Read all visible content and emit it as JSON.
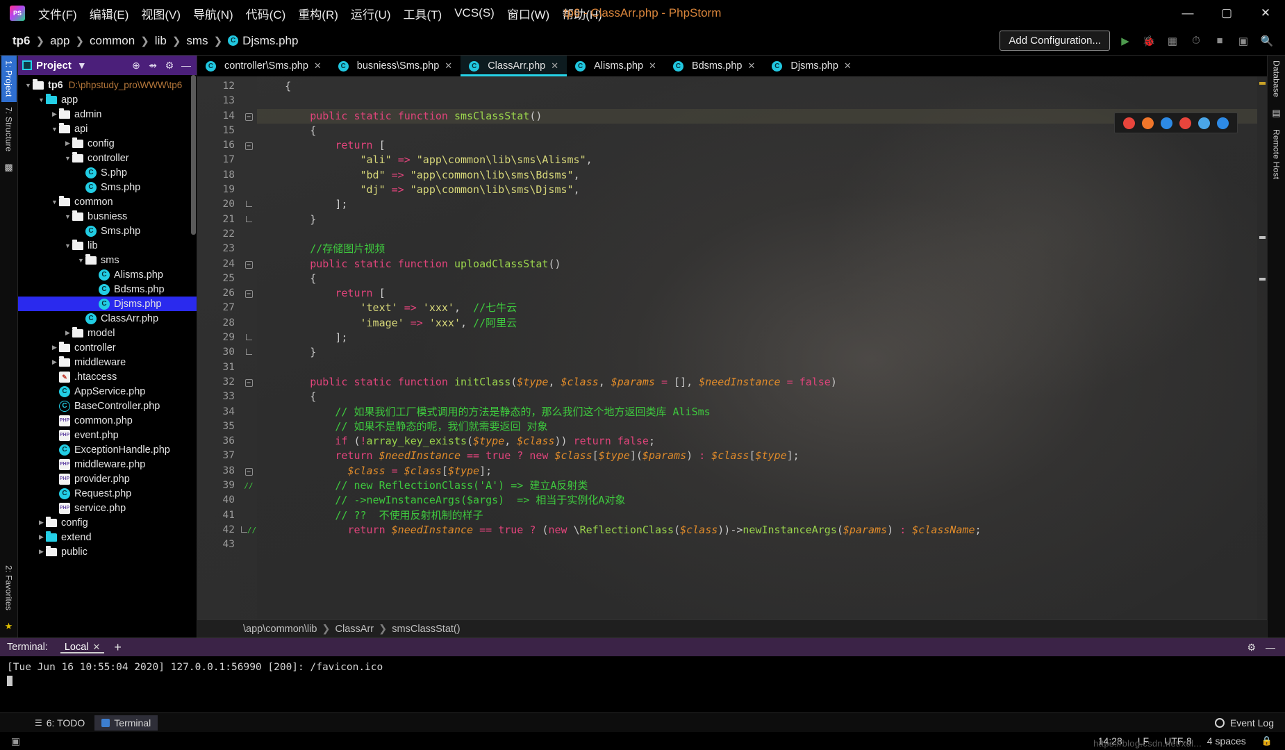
{
  "titlebar": {
    "logo": "phpstorm-logo",
    "menus": [
      "文件(F)",
      "编辑(E)",
      "视图(V)",
      "导航(N)",
      "代码(C)",
      "重构(R)",
      "运行(U)",
      "工具(T)",
      "VCS(S)",
      "窗口(W)",
      "帮助(H)"
    ],
    "window_title": "tp6 - ClassArr.php - PhpStorm",
    "minimize": "—",
    "maximize": "▢",
    "close": "✕"
  },
  "navbar": {
    "breadcrumbs": [
      "tp6",
      "app",
      "common",
      "lib",
      "sms",
      "Djsms.php"
    ],
    "separator": "❯",
    "add_configuration": "Add Configuration...",
    "icons": [
      "run-icon",
      "debug-icon",
      "coverage-icon",
      "profile-icon",
      "stop-icon",
      "layout-icon",
      "search-icon"
    ]
  },
  "left_rail": {
    "tabs": [
      "1: Project",
      "7: Structure"
    ],
    "bottom_tabs": [
      "2: Favorites"
    ]
  },
  "right_rail": {
    "tabs": [
      "Database",
      "Remote Host"
    ]
  },
  "project_panel": {
    "title": "Project",
    "chevron": "▼",
    "icons": [
      "locate-icon",
      "collapse-all-icon",
      "settings-gear-icon",
      "hide-icon"
    ],
    "tree": [
      {
        "label": "tp6",
        "path": "D:\\phpstudy_pro\\WWW\\tp6",
        "depth": 0,
        "arrow": "▼",
        "icon": "folder",
        "selected": false
      },
      {
        "label": "app",
        "path": "",
        "depth": 1,
        "arrow": "▼",
        "icon": "folder-cyan",
        "selected": false
      },
      {
        "label": "admin",
        "path": "",
        "depth": 2,
        "arrow": "▶",
        "icon": "folder",
        "selected": false
      },
      {
        "label": "api",
        "path": "",
        "depth": 2,
        "arrow": "▼",
        "icon": "folder",
        "selected": false
      },
      {
        "label": "config",
        "path": "",
        "depth": 3,
        "arrow": "▶",
        "icon": "folder",
        "selected": false
      },
      {
        "label": "controller",
        "path": "",
        "depth": 3,
        "arrow": "▼",
        "icon": "folder",
        "selected": false
      },
      {
        "label": "S.php",
        "path": "",
        "depth": 4,
        "arrow": "",
        "icon": "php-class",
        "selected": false
      },
      {
        "label": "Sms.php",
        "path": "",
        "depth": 4,
        "arrow": "",
        "icon": "php-class",
        "selected": false
      },
      {
        "label": "common",
        "path": "",
        "depth": 2,
        "arrow": "▼",
        "icon": "folder",
        "selected": false
      },
      {
        "label": "busniess",
        "path": "",
        "depth": 3,
        "arrow": "▼",
        "icon": "folder",
        "selected": false
      },
      {
        "label": "Sms.php",
        "path": "",
        "depth": 4,
        "arrow": "",
        "icon": "php-class",
        "selected": false
      },
      {
        "label": "lib",
        "path": "",
        "depth": 3,
        "arrow": "▼",
        "icon": "folder",
        "selected": false
      },
      {
        "label": "sms",
        "path": "",
        "depth": 4,
        "arrow": "▼",
        "icon": "folder",
        "selected": false
      },
      {
        "label": "Alisms.php",
        "path": "",
        "depth": 5,
        "arrow": "",
        "icon": "php-class",
        "selected": false
      },
      {
        "label": "Bdsms.php",
        "path": "",
        "depth": 5,
        "arrow": "",
        "icon": "php-class",
        "selected": false
      },
      {
        "label": "Djsms.php",
        "path": "",
        "depth": 5,
        "arrow": "",
        "icon": "php-class",
        "selected": true
      },
      {
        "label": "ClassArr.php",
        "path": "",
        "depth": 4,
        "arrow": "",
        "icon": "php-class",
        "selected": false
      },
      {
        "label": "model",
        "path": "",
        "depth": 3,
        "arrow": "▶",
        "icon": "folder",
        "selected": false
      },
      {
        "label": "controller",
        "path": "",
        "depth": 2,
        "arrow": "▶",
        "icon": "folder",
        "selected": false
      },
      {
        "label": "middleware",
        "path": "",
        "depth": 2,
        "arrow": "▶",
        "icon": "folder",
        "selected": false
      },
      {
        "label": ".htaccess",
        "path": "",
        "depth": 2,
        "arrow": "",
        "icon": "htaccess",
        "selected": false
      },
      {
        "label": "AppService.php",
        "path": "",
        "depth": 2,
        "arrow": "",
        "icon": "php-class",
        "selected": false
      },
      {
        "label": "BaseController.php",
        "path": "",
        "depth": 2,
        "arrow": "",
        "icon": "php-abstract",
        "selected": false
      },
      {
        "label": "common.php",
        "path": "",
        "depth": 2,
        "arrow": "",
        "icon": "php-file",
        "selected": false
      },
      {
        "label": "event.php",
        "path": "",
        "depth": 2,
        "arrow": "",
        "icon": "php-file",
        "selected": false
      },
      {
        "label": "ExceptionHandle.php",
        "path": "",
        "depth": 2,
        "arrow": "",
        "icon": "php-class",
        "selected": false
      },
      {
        "label": "middleware.php",
        "path": "",
        "depth": 2,
        "arrow": "",
        "icon": "php-file",
        "selected": false
      },
      {
        "label": "provider.php",
        "path": "",
        "depth": 2,
        "arrow": "",
        "icon": "php-file",
        "selected": false
      },
      {
        "label": "Request.php",
        "path": "",
        "depth": 2,
        "arrow": "",
        "icon": "php-class",
        "selected": false
      },
      {
        "label": "service.php",
        "path": "",
        "depth": 2,
        "arrow": "",
        "icon": "php-file",
        "selected": false
      },
      {
        "label": "config",
        "path": "",
        "depth": 1,
        "arrow": "▶",
        "icon": "folder",
        "selected": false
      },
      {
        "label": "extend",
        "path": "",
        "depth": 1,
        "arrow": "▶",
        "icon": "folder-cyan",
        "selected": false
      },
      {
        "label": "public",
        "path": "",
        "depth": 1,
        "arrow": "▶",
        "icon": "folder",
        "selected": false
      }
    ]
  },
  "editor": {
    "tabs": [
      {
        "label": "controller\\Sms.php",
        "active": false,
        "close": "✕"
      },
      {
        "label": "busniess\\Sms.php",
        "active": false,
        "close": "✕"
      },
      {
        "label": "ClassArr.php",
        "active": true,
        "close": "✕"
      },
      {
        "label": "Alisms.php",
        "active": false,
        "close": "✕"
      },
      {
        "label": "Bdsms.php",
        "active": false,
        "close": "✕"
      },
      {
        "label": "Djsms.php",
        "active": false,
        "close": "✕"
      }
    ],
    "first_line_number": 12,
    "lines": [
      {
        "n": 12,
        "fold": "",
        "caret": false,
        "code": "    {"
      },
      {
        "n": 13,
        "fold": "",
        "caret": false,
        "code": ""
      },
      {
        "n": 14,
        "fold": "-",
        "caret": true,
        "code": "        public static function smsClassStat()"
      },
      {
        "n": 15,
        "fold": "",
        "caret": false,
        "code": "        {"
      },
      {
        "n": 16,
        "fold": "-",
        "caret": false,
        "code": "            return ["
      },
      {
        "n": 17,
        "fold": "",
        "caret": false,
        "code": "                \"ali\" => \"app\\common\\lib\\sms\\Alisms\","
      },
      {
        "n": 18,
        "fold": "",
        "caret": false,
        "code": "                \"bd\" => \"app\\common\\lib\\sms\\Bdsms\","
      },
      {
        "n": 19,
        "fold": "",
        "caret": false,
        "code": "                \"dj\" => \"app\\common\\lib\\sms\\Djsms\","
      },
      {
        "n": 20,
        "fold": "L",
        "caret": false,
        "code": "            ];"
      },
      {
        "n": 21,
        "fold": "L",
        "caret": false,
        "code": "        }"
      },
      {
        "n": 22,
        "fold": "",
        "caret": false,
        "code": ""
      },
      {
        "n": 23,
        "fold": "",
        "caret": false,
        "code": "        //存储图片视频"
      },
      {
        "n": 24,
        "fold": "-",
        "caret": false,
        "code": "        public static function uploadClassStat()"
      },
      {
        "n": 25,
        "fold": "",
        "caret": false,
        "code": "        {"
      },
      {
        "n": 26,
        "fold": "-",
        "caret": false,
        "code": "            return ["
      },
      {
        "n": 27,
        "fold": "",
        "caret": false,
        "code": "                'text' => 'xxx',  //七牛云"
      },
      {
        "n": 28,
        "fold": "",
        "caret": false,
        "code": "                'image' => 'xxx', //阿里云"
      },
      {
        "n": 29,
        "fold": "L",
        "caret": false,
        "code": "            ];"
      },
      {
        "n": 30,
        "fold": "L",
        "caret": false,
        "code": "        }"
      },
      {
        "n": 31,
        "fold": "",
        "caret": false,
        "code": ""
      },
      {
        "n": 32,
        "fold": "-",
        "caret": false,
        "code": "        public static function initClass($type, $class, $params = [], $needInstance = false)"
      },
      {
        "n": 33,
        "fold": "",
        "caret": false,
        "code": "        {"
      },
      {
        "n": 34,
        "fold": "",
        "caret": false,
        "code": "            // 如果我们工厂模式调用的方法是静态的，那么我们这个地方返回类库 AliSms"
      },
      {
        "n": 35,
        "fold": "",
        "caret": false,
        "code": "            // 如果不是静态的呢，我们就需要返回 对象"
      },
      {
        "n": 36,
        "fold": "",
        "caret": false,
        "code": "            if (!array_key_exists($type, $class)) return false;"
      },
      {
        "n": 37,
        "fold": "",
        "caret": false,
        "code": "            return $needInstance == true ? new $class[$type]($params) : $class[$type];"
      },
      {
        "n": 38,
        "fold": "-//",
        "caret": false,
        "code": "              $class = $class[$type];"
      },
      {
        "n": 39,
        "fold": "",
        "caret": false,
        "code": "            // new ReflectionClass('A') => 建立A反射类"
      },
      {
        "n": 40,
        "fold": "",
        "caret": false,
        "code": "            // ->newInstanceArgs($args)  => 相当于实例化A对象"
      },
      {
        "n": 41,
        "fold": "",
        "caret": false,
        "code": "            // ??  不使用反射机制的样子"
      },
      {
        "n": 42,
        "fold": "L//",
        "caret": false,
        "code": "              return $needInstance == true ? (new \\ReflectionClass($class))->newInstanceArgs($params) : $className;"
      },
      {
        "n": 43,
        "fold": "",
        "caret": false,
        "code": ""
      }
    ],
    "breadcrumbs": [
      "\\app\\common\\lib",
      "ClassArr",
      "smsClassStat()"
    ],
    "breadcrumb_sep": "❯",
    "browser_popup": [
      "chrome-icon",
      "firefox-icon",
      "safari-icon",
      "opera-icon",
      "edge-legacy-icon",
      "edge-icon"
    ]
  },
  "terminal": {
    "title": "Terminal:",
    "tab": "Local",
    "tab_close": "✕",
    "add": "+",
    "gear": "gear-icon",
    "hide": "—",
    "output": "[Tue Jun 16 10:55:04 2020] 127.0.0.1:56990 [200]: /favicon.ico"
  },
  "bottom_tabs": {
    "items": [
      {
        "label": "6: TODO",
        "icon": "list-icon",
        "active": false
      },
      {
        "label": "Terminal",
        "icon": "terminal-icon",
        "active": true
      }
    ],
    "event_log": "Event Log"
  },
  "statusbar": {
    "time": "14:28",
    "line_sep": "LF",
    "encoding": "UTF-8",
    "indent": "4 spaces",
    "lock": "🔒",
    "watermark": "https://blog.csdn.net/xul..."
  }
}
